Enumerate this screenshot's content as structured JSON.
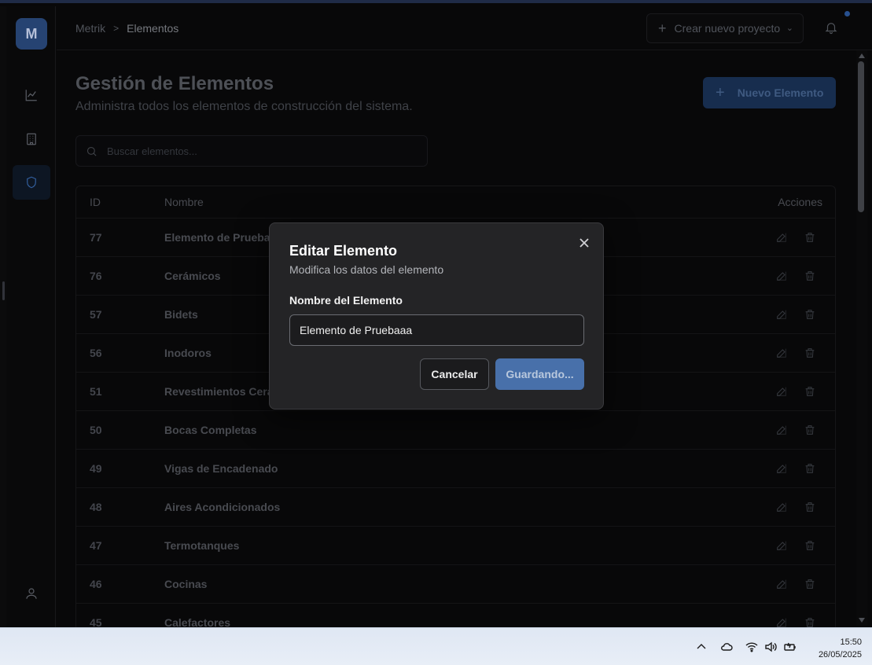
{
  "app": {
    "logo_letter": "M"
  },
  "breadcrumb": {
    "root": "Metrik",
    "separator": ">",
    "current": "Elementos"
  },
  "header": {
    "create_project_label": "Crear nuevo proyecto"
  },
  "page": {
    "title": "Gestión de Elementos",
    "subtitle": "Administra todos los elementos de construcción del sistema.",
    "new_button_label": "Nuevo Elemento",
    "search_placeholder": "Buscar elementos..."
  },
  "table": {
    "headers": {
      "id": "ID",
      "name": "Nombre",
      "actions": "Acciones"
    },
    "rows": [
      {
        "id": "77",
        "name": "Elemento de Pruebaaa"
      },
      {
        "id": "76",
        "name": "Cerámicos"
      },
      {
        "id": "57",
        "name": "Bidets"
      },
      {
        "id": "56",
        "name": "Inodoros"
      },
      {
        "id": "51",
        "name": "Revestimientos Cerámicos"
      },
      {
        "id": "50",
        "name": "Bocas Completas"
      },
      {
        "id": "49",
        "name": "Vigas de Encadenado"
      },
      {
        "id": "48",
        "name": "Aires Acondicionados"
      },
      {
        "id": "47",
        "name": "Termotanques"
      },
      {
        "id": "46",
        "name": "Cocinas"
      },
      {
        "id": "45",
        "name": "Calefactores"
      }
    ]
  },
  "modal": {
    "title": "Editar Elemento",
    "subtitle": "Modifica los datos del elemento",
    "field_label": "Nombre del Elemento",
    "field_value": "Elemento de Pruebaaa",
    "cancel_label": "Cancelar",
    "save_label": "Guardando..."
  },
  "taskbar": {
    "time": "15:50",
    "date": "26/05/2025"
  },
  "colors": {
    "accent": "#2d4f86",
    "modal_bg": "#242426",
    "save_button": "#4870aa"
  }
}
